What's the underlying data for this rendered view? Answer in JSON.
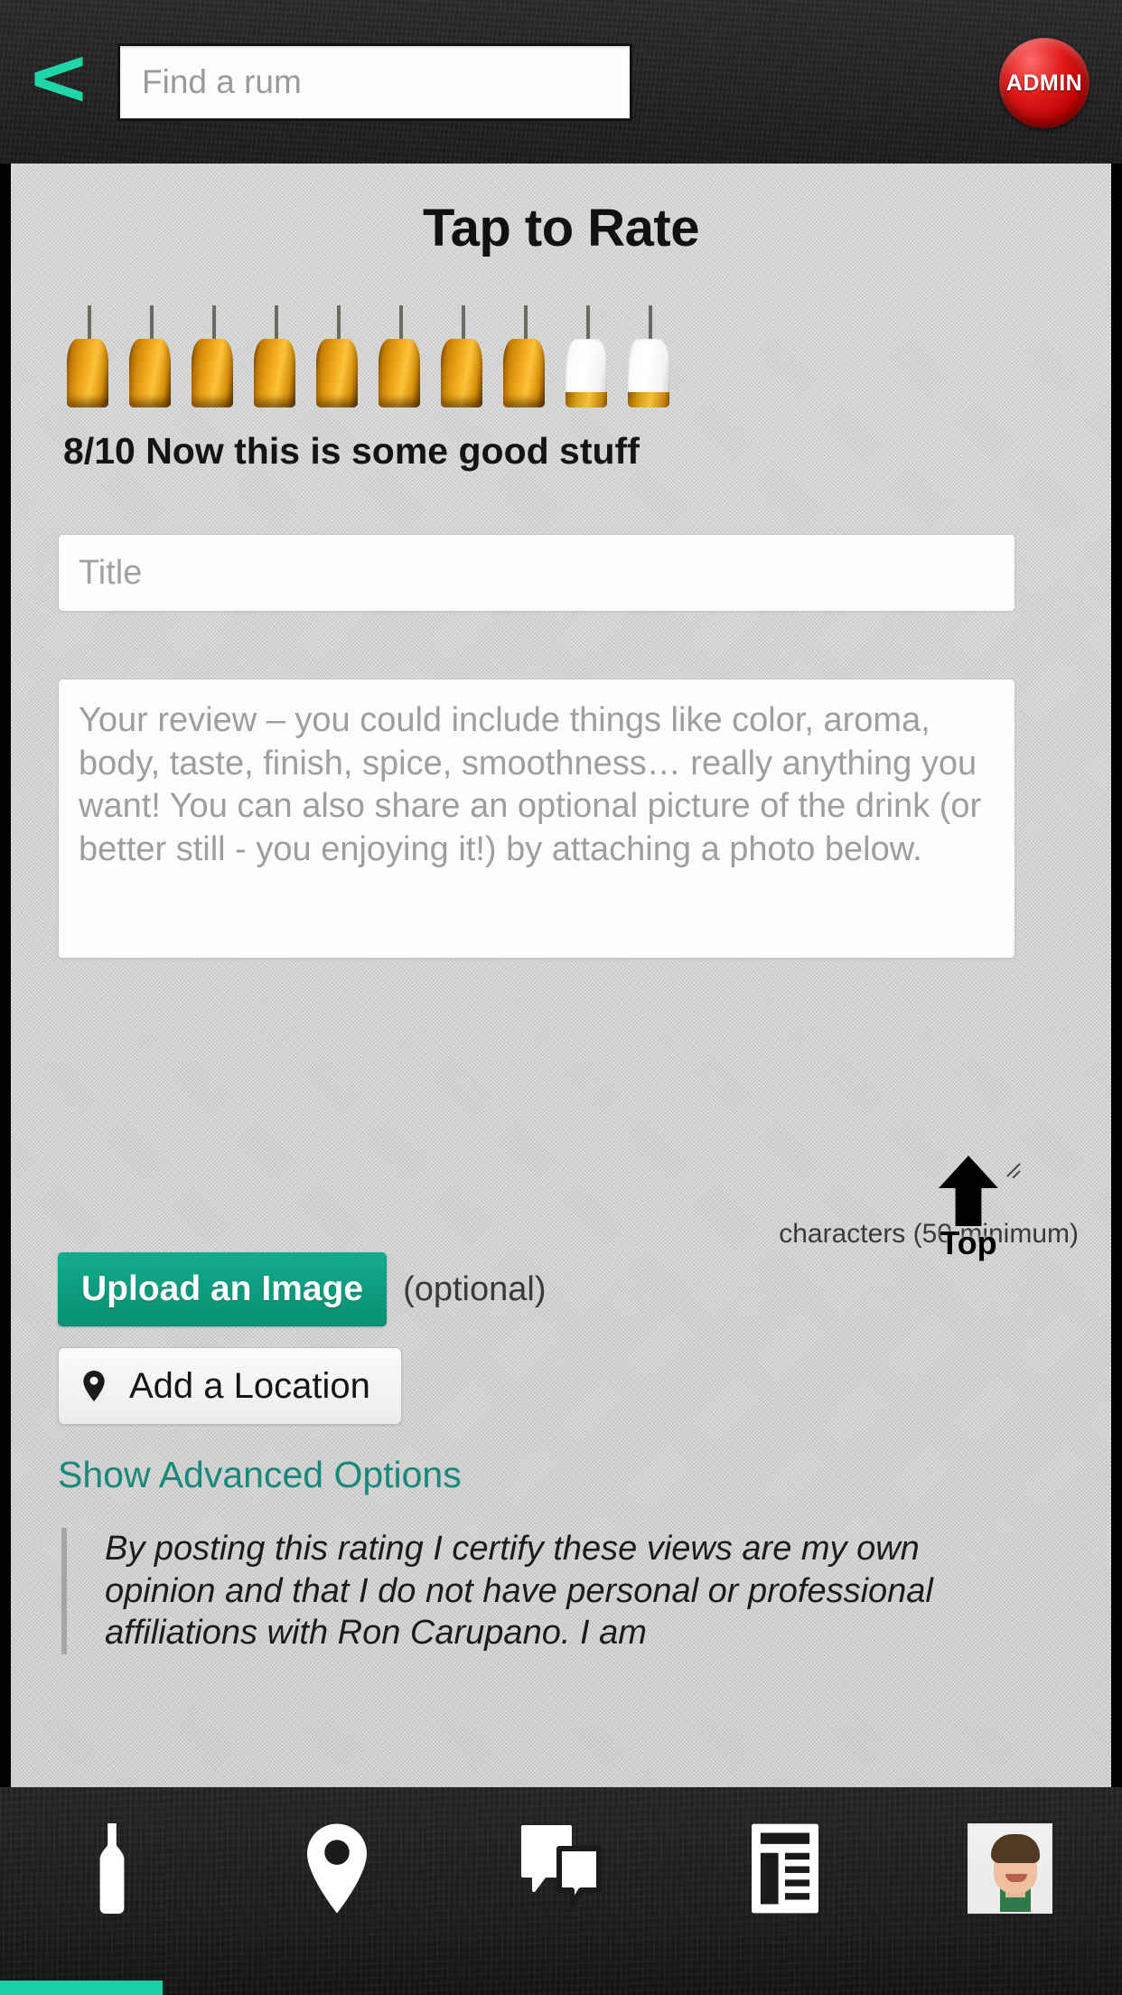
{
  "topbar": {
    "back_label": "<",
    "back_icon": "back-chevron-icon",
    "search_placeholder": "Find a rum",
    "search_value": "",
    "admin_label": "ADMIN",
    "accent_color": "#1fd6a8",
    "admin_color": "#d41414",
    "background_color": "#222222"
  },
  "main": {
    "title": "Tap to Rate",
    "rating": {
      "score": 8,
      "max": 10,
      "summary_text": "8/10 Now this is some good stuff",
      "bottles": [
        {
          "index": 1,
          "state": "filled"
        },
        {
          "index": 2,
          "state": "filled"
        },
        {
          "index": 3,
          "state": "filled"
        },
        {
          "index": 4,
          "state": "filled"
        },
        {
          "index": 5,
          "state": "filled"
        },
        {
          "index": 6,
          "state": "filled"
        },
        {
          "index": 7,
          "state": "filled"
        },
        {
          "index": 8,
          "state": "filled"
        },
        {
          "index": 9,
          "state": "empty"
        },
        {
          "index": 10,
          "state": "empty"
        }
      ]
    },
    "title_field": {
      "placeholder": "Title",
      "value": ""
    },
    "review_field": {
      "placeholder": "Your review – you could include things like color, aroma, body, taste, finish, spice, smoothness… really anything you want! You can also share an optional picture of the drink (or better still - you enjoying it!) by attaching a photo below.",
      "value": ""
    },
    "char_note": "characters (50 minimum)",
    "upload_button": "Upload an Image",
    "upload_optional_note": "(optional)",
    "upload_color": "#0d9b7e",
    "location_button": "Add a Location",
    "location_icon": "map-pin-icon",
    "advanced_link": "Show Advanced Options",
    "advanced_link_color": "#16897a",
    "disclaimer": "By posting this rating I certify these views are my own opinion and that I do not have personal or professional affiliations with Ron Carupano. I am"
  },
  "scroll_top": {
    "label": "Top",
    "icon": "arrow-up-icon"
  },
  "bottomnav": {
    "items": [
      {
        "name": "bottle",
        "icon": "bottle-icon",
        "label": ""
      },
      {
        "name": "map",
        "icon": "map-pin-icon",
        "label": ""
      },
      {
        "name": "chat",
        "icon": "chat-bubbles-icon",
        "label": ""
      },
      {
        "name": "feed",
        "icon": "news-list-icon",
        "label": ""
      },
      {
        "name": "profile",
        "icon": "avatar-photo",
        "label": ""
      }
    ]
  },
  "progress": {
    "percent": 14,
    "color": "#19cfa6"
  }
}
